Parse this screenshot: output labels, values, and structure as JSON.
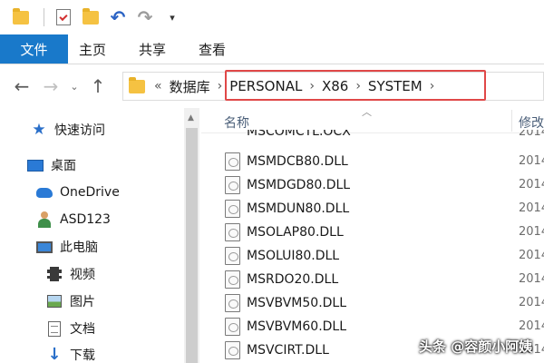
{
  "quick_access_toolbar": {
    "items": [
      "folder-icon",
      "properties-icon",
      "new-folder-icon",
      "undo-icon",
      "redo-icon"
    ],
    "dropdown_symbol": "▾"
  },
  "ribbon": {
    "file_tab": "文件",
    "tabs": [
      "主页",
      "共享",
      "查看"
    ],
    "accent_color": "#1979ca"
  },
  "address_bar": {
    "back_symbol": "←",
    "forward_symbol": "→",
    "recent_symbol": "⌄",
    "up_symbol": "↑",
    "overflow": "«",
    "crumbs": [
      "数据库",
      "PERSONAL",
      "X86",
      "SYSTEM"
    ],
    "separator": "›",
    "highlight_color": "#e04848"
  },
  "nav_pane": {
    "items": [
      {
        "label": "快速访问",
        "icon": "star-icon"
      },
      {
        "label": "桌面",
        "icon": "desktop-icon"
      },
      {
        "label": "OneDrive",
        "icon": "onedrive-icon"
      },
      {
        "label": "ASD123",
        "icon": "user-icon"
      },
      {
        "label": "此电脑",
        "icon": "this-pc-icon"
      },
      {
        "label": "视频",
        "icon": "video-icon"
      },
      {
        "label": "图片",
        "icon": "pictures-icon"
      },
      {
        "label": "文档",
        "icon": "documents-icon"
      },
      {
        "label": "下载",
        "icon": "download-icon"
      }
    ]
  },
  "file_list": {
    "columns": {
      "name": "名称",
      "modified": "修改"
    },
    "files": [
      {
        "name": "MSCOMCTL.OCX",
        "date": "2014"
      },
      {
        "name": "MSMDCB80.DLL",
        "date": "2014"
      },
      {
        "name": "MSMDGD80.DLL",
        "date": "2014"
      },
      {
        "name": "MSMDUN80.DLL",
        "date": "2014"
      },
      {
        "name": "MSOLAP80.DLL",
        "date": "2014"
      },
      {
        "name": "MSOLUI80.DLL",
        "date": "2014"
      },
      {
        "name": "MSRDO20.DLL",
        "date": "2014"
      },
      {
        "name": "MSVBVM50.DLL",
        "date": "2014"
      },
      {
        "name": "MSVBVM60.DLL",
        "date": "2014"
      },
      {
        "name": "MSVCIRT.DLL",
        "date": "2014"
      }
    ]
  },
  "watermark": "头条 @容颜小阿姨"
}
